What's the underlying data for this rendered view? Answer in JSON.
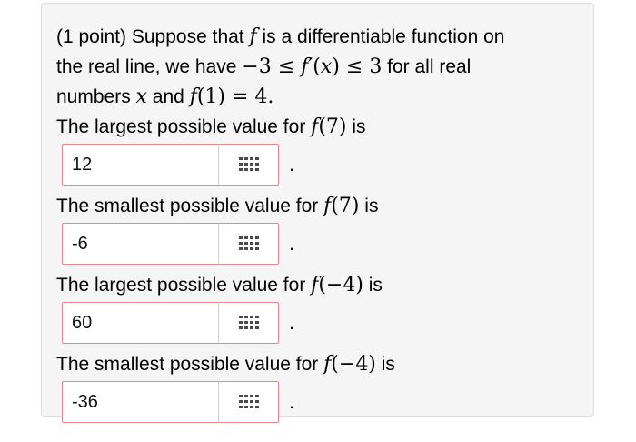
{
  "problem": {
    "line1_prefix": "(1 point) Suppose that ",
    "f": "f",
    "line1_suffix": " is a differentiable function on",
    "line2_prefix": "the real line, we have ",
    "ineq": "−3 ≤ ",
    "fprime": "f′",
    "ineq_arg": "(",
    "x": "x",
    "ineq_end": ") ≤ 3",
    "line2_suffix": " for all real",
    "line3_prefix": "numbers ",
    "line3_mid": " and ",
    "cond_open": "(1) = 4.",
    "cond_empty": ""
  },
  "questions": [
    {
      "text": "The largest possible value for ",
      "arg": "(7)",
      "suffix": " is",
      "answer": "12"
    },
    {
      "text": "The smallest possible value for ",
      "arg": "(7)",
      "suffix": " is",
      "answer": "-6"
    },
    {
      "text": "The largest possible value for ",
      "arg": "(−4)",
      "suffix": " is",
      "answer": "60"
    },
    {
      "text": "The smallest possible value for ",
      "arg": "(−4)",
      "suffix": " is",
      "answer": "-36"
    }
  ],
  "punct": {
    "period": "."
  },
  "colors": {
    "input_border": "#e3878c",
    "card_bg": "#f5f5f5",
    "icon": "#4a4a4a"
  },
  "icons": {
    "keypad": "keypad-grid-icon"
  }
}
